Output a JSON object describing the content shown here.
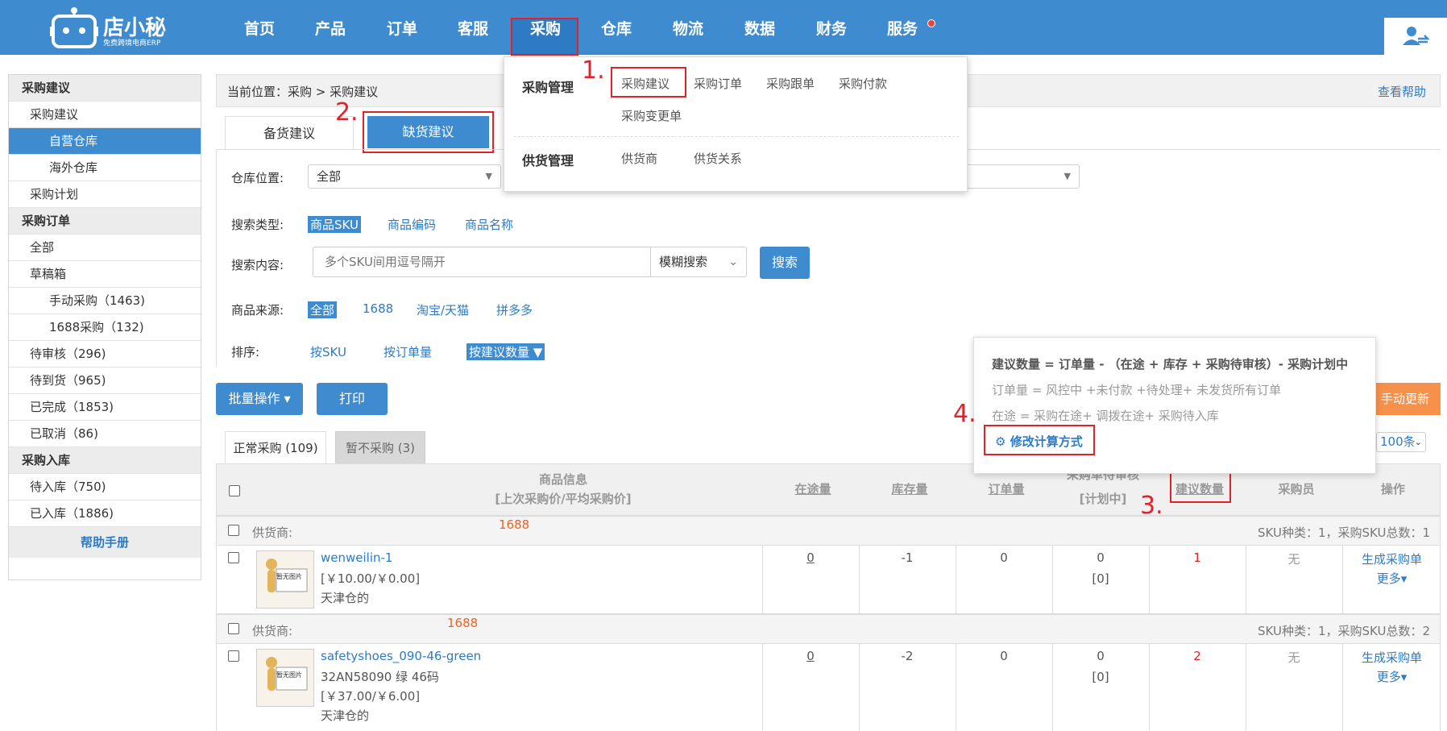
{
  "brand": {
    "name": "店小秘",
    "tagline": "免费跨境电商ERP"
  },
  "nav": [
    "首页",
    "产品",
    "订单",
    "客服",
    "采购",
    "仓库",
    "物流",
    "数据",
    "财务",
    "服务"
  ],
  "menu": {
    "group1": "采购管理",
    "group1_items": [
      "采购建议",
      "采购订单",
      "采购跟单",
      "采购付款",
      "采购变更单"
    ],
    "group2": "供货管理",
    "group2_items": [
      "供货商",
      "供货关系"
    ]
  },
  "steps": [
    "1.",
    "2.",
    "3.",
    "4."
  ],
  "sidebar": [
    {
      "label": "采购建议",
      "type": "head"
    },
    {
      "label": "采购建议",
      "type": "item"
    },
    {
      "label": "自营仓库",
      "type": "sub",
      "active": true
    },
    {
      "label": "海外仓库",
      "type": "sub"
    },
    {
      "label": "采购计划",
      "type": "item"
    },
    {
      "label": "采购订单",
      "type": "head"
    },
    {
      "label": "全部",
      "type": "item"
    },
    {
      "label": "草稿箱",
      "type": "item"
    },
    {
      "label": "手动采购（1463)",
      "type": "sub"
    },
    {
      "label": "1688采购（132)",
      "type": "sub"
    },
    {
      "label": "待审核（296)",
      "type": "item"
    },
    {
      "label": "待到货（965)",
      "type": "item"
    },
    {
      "label": "已完成（1853)",
      "type": "item"
    },
    {
      "label": "已取消（86)",
      "type": "item"
    },
    {
      "label": "采购入库",
      "type": "head"
    },
    {
      "label": "待入库（750)",
      "type": "item"
    },
    {
      "label": "已入库（1886)",
      "type": "item"
    },
    {
      "label": "帮助手册",
      "type": "help"
    }
  ],
  "breadcrumb": "当前位置：采购 > 采购建议",
  "help_link": "查看帮助",
  "tabs": {
    "stock": "备货建议",
    "shortage": "缺货建议"
  },
  "filters": {
    "warehouse_label": "仓库位置:",
    "warehouse_value": "全部",
    "search_type_label": "搜索类型:",
    "search_types": [
      "商品SKU",
      "商品编码",
      "商品名称"
    ],
    "search_content_label": "搜索内容:",
    "search_placeholder": "多个SKU间用逗号隔开",
    "match_mode": "模糊搜索",
    "search_button": "搜索",
    "source_label": "商品来源:",
    "sources": [
      "全部",
      "1688",
      "淘宝/天猫",
      "拼多多"
    ],
    "sort_label": "排序:",
    "sorts": [
      "按SKU",
      "按订单量",
      "按建议数量 ▼"
    ]
  },
  "actions": {
    "batch": "批量操作 ▾",
    "print": "打印",
    "manual_update": "手动更新",
    "page_size": "100条"
  },
  "subtabs": {
    "normal": "正常采购 (109)",
    "paused": "暂不采购 (3)"
  },
  "tooltip": {
    "line1": "建议数量 = 订单量 - （在途 + 库存 + 采购待审核）- 采购计划中",
    "line2": "订单量 = 风控中 +未付款 +待处理+ 未发货所有订单",
    "line3": "在途 = 采购在途+ 调拨在途+ 采购待入库",
    "link": "修改计算方式"
  },
  "table": {
    "headers": {
      "product": "商品信息",
      "product_sub": "[上次采购价/平均采购价]",
      "in_transit": "在途量",
      "stock": "库存量",
      "orders": "订单量",
      "pending": "采购单待审核",
      "pending_sub": "[计划中]",
      "suggested": "建议数量",
      "buyer": "采购员",
      "ops": "操作"
    },
    "groups": [
      {
        "supplier_label": "供货商:",
        "supplier": "1688",
        "summary": "SKU种类：1，采购SKU总数：1",
        "row": {
          "thumb": "暂无图片",
          "sku": "wenweilin-1",
          "lines": [
            "[￥10.00/￥0.00]",
            "天津仓的"
          ],
          "in_transit": "0",
          "stock": "-1",
          "orders": "0",
          "pending": "0",
          "plan": "[0]",
          "suggested": "1",
          "buyer": "无",
          "op1": "生成采购单",
          "op2": "更多▾"
        }
      },
      {
        "supplier_label": "供货商:",
        "supplier": "1688",
        "summary": "SKU种类：1，采购SKU总数：2",
        "row": {
          "thumb": "暂无图片",
          "sku": "safetyshoes_090-46-green",
          "lines": [
            "32AN58090 绿 46码",
            "[￥37.00/￥6.00]",
            "天津仓的"
          ],
          "in_transit": "0",
          "stock": "-2",
          "orders": "0",
          "pending": "0",
          "plan": "[0]",
          "suggested": "2",
          "buyer": "无",
          "op1": "生成采购单",
          "op2": "更多▾"
        }
      }
    ]
  }
}
